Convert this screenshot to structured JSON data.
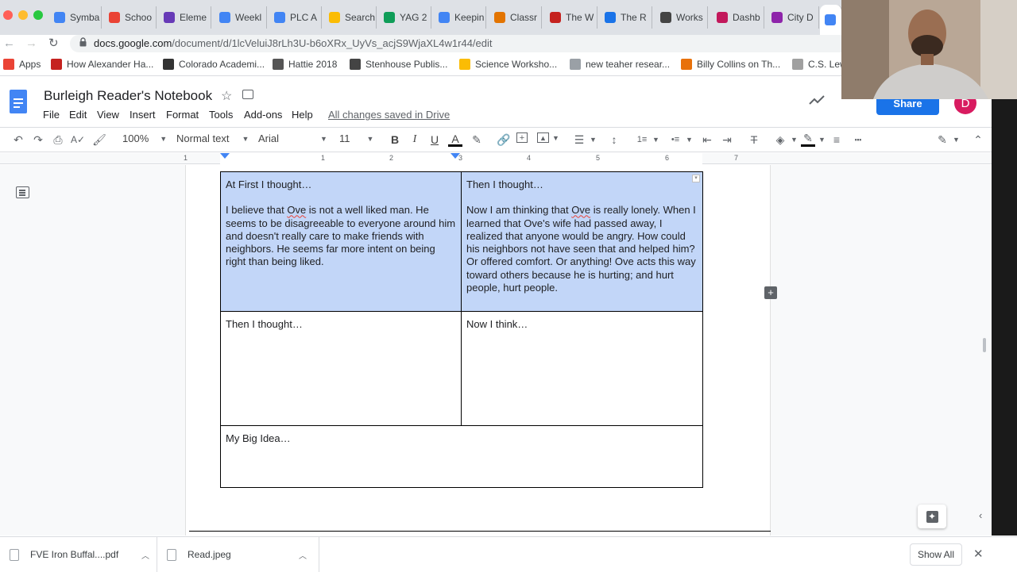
{
  "browser": {
    "tabs": [
      {
        "label": "Symba",
        "color": "#4285f4"
      },
      {
        "label": "Schoo",
        "color": "#ea4335"
      },
      {
        "label": "Eleme",
        "color": "#673ab7"
      },
      {
        "label": "Weekl",
        "color": "#4285f4"
      },
      {
        "label": "PLC A",
        "color": "#4285f4"
      },
      {
        "label": "Search",
        "color": "#fbbc04"
      },
      {
        "label": "YAG 2",
        "color": "#0f9d58"
      },
      {
        "label": "Keepin",
        "color": "#4285f4"
      },
      {
        "label": "Classr",
        "color": "#e37400"
      },
      {
        "label": "The W",
        "color": "#c5221f"
      },
      {
        "label": "The R",
        "color": "#1a73e8"
      },
      {
        "label": "Works",
        "color": "#444444"
      },
      {
        "label": "Dashb",
        "color": "#c2185b"
      },
      {
        "label": "City D",
        "color": "#8e24aa"
      }
    ],
    "url_host": "docs.google.com",
    "url_path": "/document/d/1lcVeluiJ8rLh3U-b6oXRx_UyVs_acjS9WjaXL4w1r44/edit",
    "bookmarks": [
      {
        "label": "Apps",
        "color": "#ea4335"
      },
      {
        "label": "How Alexander Ha...",
        "color": "#c5221f"
      },
      {
        "label": "Colorado Academi...",
        "color": "#333333"
      },
      {
        "label": "Hattie 2018",
        "color": "#555555"
      },
      {
        "label": "Stenhouse Publis...",
        "color": "#444444"
      },
      {
        "label": "Science Worksho...",
        "color": "#fbbc04"
      },
      {
        "label": "new teaher resear...",
        "color": "#9aa0a6"
      },
      {
        "label": "Billy Collins on Th...",
        "color": "#e8710a"
      },
      {
        "label": "C.S. Lew",
        "color": "#a0a0a0"
      }
    ]
  },
  "doc": {
    "title": "Burleigh Reader's Notebook",
    "menu": [
      "File",
      "Edit",
      "View",
      "Insert",
      "Format",
      "Tools",
      "Add-ons",
      "Help"
    ],
    "save_status": "All changes saved in Drive",
    "share_label": "Share",
    "avatar_letter": "D",
    "toolbar": {
      "zoom": "100%",
      "style": "Normal text",
      "font": "Arial",
      "font_size": "11"
    },
    "ruler_numbers": [
      "1",
      "1",
      "2",
      "3",
      "4",
      "5",
      "6",
      "7"
    ]
  },
  "table": {
    "cell1_heading": "At First I thought…",
    "cell1_body_a": "I believe that ",
    "cell1_ove": "Ove",
    "cell1_body_b": " is not a well liked man. He seems to be disagreeable to everyone around him and doesn't really care to make friends with neighbors. He seems far more intent on being right than being liked.",
    "cell2_heading": "Then I thought…",
    "cell2_body_a": "Now I am thinking that ",
    "cell2_ove": "Ove",
    "cell2_body_b": " is really lonely. When I learned that Ove's wife had passed away, I realized that anyone would be angry. How could his neighbors not have seen that and helped him? Or offered comfort. Or anything! Ove acts this way toward others because he is hurting; and hurt people, hurt people.",
    "cell3_heading": "Then I thought…",
    "cell4_heading": "Now I think…",
    "cell5_heading": "My Big Idea…"
  },
  "downloads": {
    "items": [
      {
        "name": "FVE Iron Buffal....pdf"
      },
      {
        "name": "Read.jpeg"
      }
    ],
    "show_all": "Show All"
  }
}
